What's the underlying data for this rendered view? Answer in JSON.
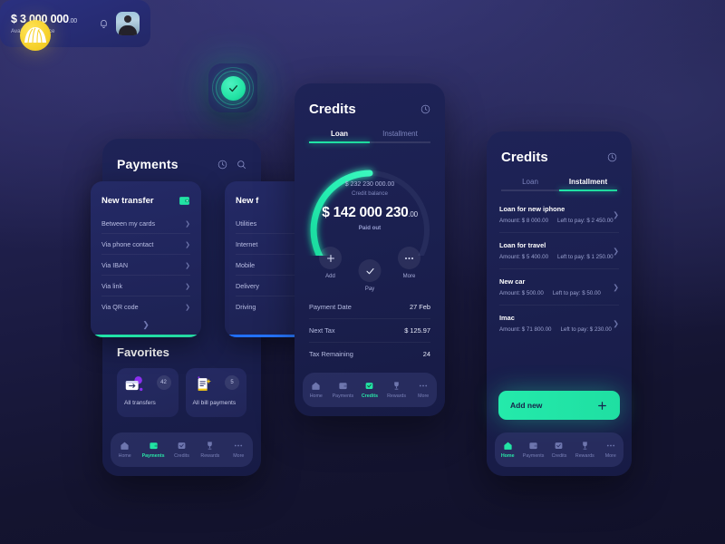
{
  "logo": {
    "name": "brand-logo"
  },
  "app_icon": {
    "name": "app-icon-check"
  },
  "colors": {
    "accent_green": "#21e6a8",
    "accent_blue": "#1f6dff",
    "card_bg": "#1e2357",
    "page_bg": "#1a1a40",
    "text_primary": "#ffffff",
    "text_muted": "#9aa1cf"
  },
  "payments_phone": {
    "title": "Payments",
    "header_icons": [
      "clock-icon",
      "search-icon"
    ],
    "sheets": [
      {
        "title": "New transfer",
        "icon": "wallet-icon",
        "accent": "#21e6a8",
        "items": [
          "Between my cards",
          "Via phone contact",
          "Via IBAN",
          "Via link",
          "Via QR code"
        ],
        "expand_icon": "chevron-down-icon"
      },
      {
        "title": "New f",
        "accent": "#1f6dff",
        "items": [
          "Utilities",
          "Internet",
          "Mobile",
          "Delivery",
          "Driving"
        ]
      }
    ],
    "favorites": {
      "title": "Favorites",
      "cards": [
        {
          "label": "All transfers",
          "count": "42",
          "icon": "transfers-icon"
        },
        {
          "label": "All bill payments",
          "count": "5",
          "icon": "bill-icon"
        }
      ]
    },
    "nav": [
      {
        "label": "Home",
        "icon": "home-icon",
        "active": false
      },
      {
        "label": "Payments",
        "icon": "wallet-icon",
        "active": true
      },
      {
        "label": "Credits",
        "icon": "card-check-icon",
        "active": false
      },
      {
        "label": "Rewards",
        "icon": "trophy-icon",
        "active": false
      },
      {
        "label": "More",
        "icon": "dots-icon",
        "active": false
      }
    ]
  },
  "credits_phone": {
    "title": "Credits",
    "header_icon": "clock-icon",
    "tabs": [
      {
        "label": "Loan",
        "active": true
      },
      {
        "label": "Installment",
        "active": false
      }
    ],
    "gauge": {
      "credit_balance_amount": "$ 232 230 000.00",
      "credit_balance_label": "Credit balance",
      "paid_out_amount": "$ 142 000 230",
      "paid_out_cents": ".00",
      "paid_out_label": "Paid out",
      "progress_percent": 61,
      "arc_color": "#21e6a8",
      "track_color": "#2a3060"
    },
    "actions": [
      {
        "label": "Add",
        "icon": "plus-icon"
      },
      {
        "label": "Pay",
        "icon": "check-icon"
      },
      {
        "label": "More",
        "icon": "dots-icon"
      }
    ],
    "details": [
      {
        "key": "Payment Date",
        "value": "27 Feb"
      },
      {
        "key": "Next Tax",
        "value": "$ 125.97"
      },
      {
        "key": "Tax Remaining",
        "value": "24"
      }
    ],
    "nav": [
      {
        "label": "Home",
        "icon": "home-icon",
        "active": false
      },
      {
        "label": "Payments",
        "icon": "wallet-icon",
        "active": false
      },
      {
        "label": "Credits",
        "icon": "card-check-icon",
        "active": true
      },
      {
        "label": "Rewards",
        "icon": "trophy-icon",
        "active": false
      },
      {
        "label": "More",
        "icon": "dots-icon",
        "active": false
      }
    ]
  },
  "balance_card": {
    "amount": "$ 3 000 000",
    "cents": ".00",
    "label": "Available balance",
    "bell_icon": "bell-icon",
    "avatar": "user-avatar"
  },
  "credits_card": {
    "title": "Credits",
    "header_icon": "clock-icon",
    "tabs": [
      {
        "label": "Loan",
        "active": false
      },
      {
        "label": "Installment",
        "active": true
      }
    ],
    "installments": [
      {
        "name": "Loan for new iphone",
        "amount": "Amount: $ 8 000.00",
        "left": "Left to pay: $ 2 450.00"
      },
      {
        "name": "Loan for travel",
        "amount": "Amount: $ 5 400.00",
        "left": "Left to pay: $ 1 250.00"
      },
      {
        "name": "New car",
        "amount": "Amount: $ 500.00",
        "left": "Left to pay: $ 50.00"
      },
      {
        "name": "Imac",
        "amount": "Amount: $ 71 800.00",
        "left": "Left to pay: $ 230.00"
      }
    ],
    "add_button": {
      "label": "Add new",
      "icon": "plus-icon"
    },
    "nav": [
      {
        "label": "Home",
        "icon": "home-icon",
        "active": true
      },
      {
        "label": "Payments",
        "icon": "wallet-icon",
        "active": false
      },
      {
        "label": "Credits",
        "icon": "card-check-icon",
        "active": false
      },
      {
        "label": "Rewards",
        "icon": "trophy-icon",
        "active": false
      },
      {
        "label": "More",
        "icon": "dots-icon",
        "active": false
      }
    ]
  }
}
